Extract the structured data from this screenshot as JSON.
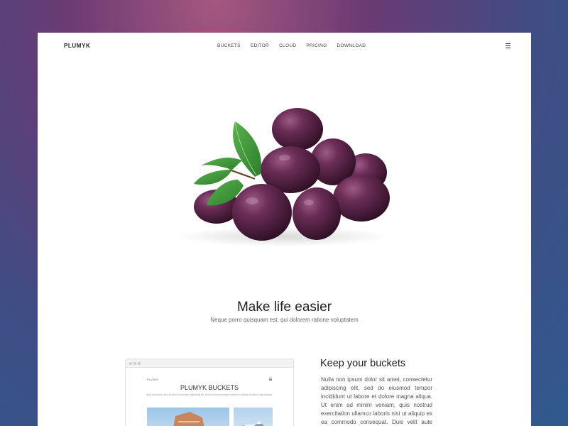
{
  "nav": {
    "logo": "PLUMYK",
    "items": [
      "BUCKETS",
      "EDITOR",
      "CLOUD",
      "PRICING",
      "DOWNLOAD"
    ]
  },
  "hero": {
    "image": "plums-with-leaves",
    "headline": "Make life easier",
    "subline": "Neque porro quisquam est, qui dolorem ratione voluptatem"
  },
  "feature": {
    "mockup": {
      "logo": "PLUMYK",
      "title": "PLUMYK BUCKETS",
      "subtitle": "Nulla non ipsum dolor sit amet, consectetur adipiscing elit, sed do eiusmod tempor incididunt ut labore et dolore magna aliqua."
    },
    "title": "Keep your buckets",
    "text": "Nulla non ipsum dolor sit amet, consectetur adipiscing elit, sed do eiusmod tempor incididunt ut labore et dolore magna aliqua. Ut enim ad minim veniam, quis nostrud exercitation ullamco laboris nisi ut aliquip ex ea commodo consequat. Duis velit aute irure"
  },
  "colors": {
    "background_top": "#a5587f",
    "background_bottom": "#2f5a8d",
    "plum": "#5a2447",
    "leaf": "#3f9a3c"
  }
}
